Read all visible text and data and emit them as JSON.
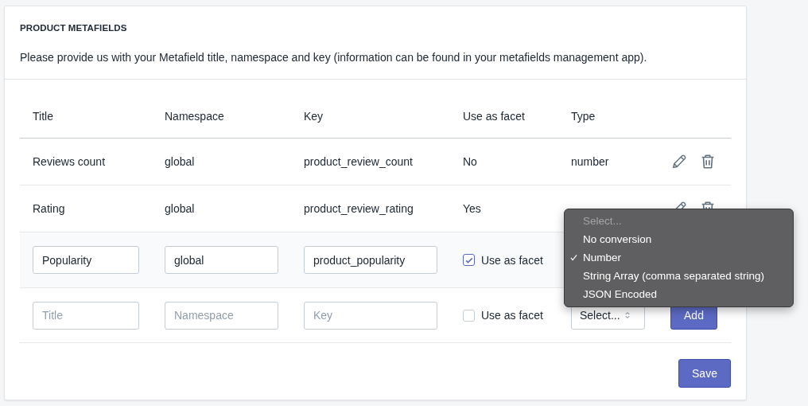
{
  "section": {
    "title": "PRODUCT METAFIELDS",
    "description": "Please provide us with your Metafield title, namespace and key (information can be found in your metafields management app)."
  },
  "table": {
    "columns": [
      "Title",
      "Namespace",
      "Key",
      "Use as facet",
      "Type"
    ],
    "rows": [
      {
        "title": "Reviews count",
        "namespace": "global",
        "key": "product_review_count",
        "facet": "No",
        "type": "number"
      },
      {
        "title": "Rating",
        "namespace": "global",
        "key": "product_review_rating",
        "facet": "Yes"
      }
    ],
    "edit_row": {
      "title": "Popularity",
      "namespace": "global",
      "key": "product_popularity",
      "facet_checked": true,
      "facet_label": "Use as facet"
    },
    "new_row": {
      "title_placeholder": "Title",
      "namespace_placeholder": "Namespace",
      "key_placeholder": "Key",
      "facet_checked": false,
      "facet_label": "Use as facet",
      "type_select": "Select...",
      "add_button": "Add"
    }
  },
  "type_menu": {
    "options": [
      {
        "label": "Select...",
        "disabled": true,
        "selected": false
      },
      {
        "label": "No conversion",
        "disabled": false,
        "selected": false
      },
      {
        "label": "Number",
        "disabled": false,
        "selected": true
      },
      {
        "label": "String Array (comma separated string)",
        "disabled": false,
        "selected": false
      },
      {
        "label": "JSON Encoded",
        "disabled": false,
        "selected": false
      }
    ]
  },
  "save_button": "Save"
}
